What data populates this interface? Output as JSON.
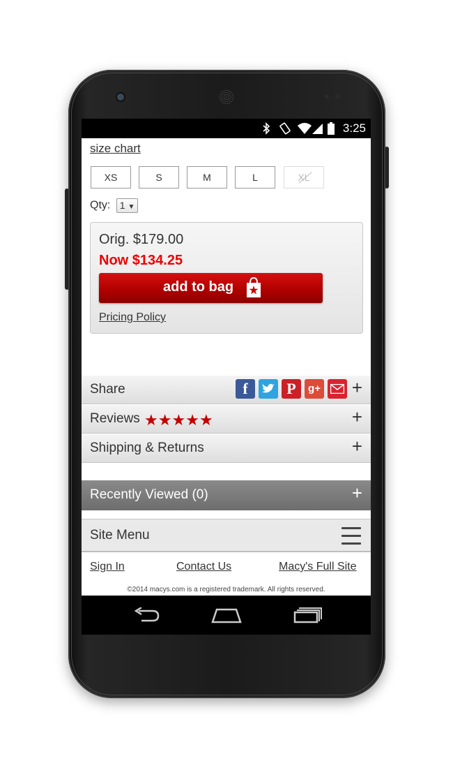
{
  "status_bar": {
    "time": "3:25",
    "icons": [
      "bluetooth-icon",
      "rotation-icon",
      "wifi-icon",
      "signal-icon",
      "battery-icon"
    ]
  },
  "product": {
    "size_chart_link": "size chart",
    "sizes": [
      {
        "label": "XS",
        "available": true
      },
      {
        "label": "S",
        "available": true
      },
      {
        "label": "M",
        "available": true
      },
      {
        "label": "L",
        "available": true
      },
      {
        "label": "XL",
        "available": false
      }
    ],
    "qty_label": "Qty:",
    "qty_value": "1",
    "orig_price": "Orig. $179.00",
    "now_price": "Now $134.25",
    "add_to_bag": "add to bag",
    "pricing_policy": "Pricing Policy"
  },
  "sections": {
    "share": {
      "label": "Share",
      "icons": [
        "facebook-icon",
        "twitter-icon",
        "pinterest-icon",
        "google-plus-icon",
        "email-icon"
      ]
    },
    "reviews": {
      "label": "Reviews",
      "rating": 5,
      "max_rating": 5
    },
    "shipping": {
      "label": "Shipping & Returns"
    },
    "plus": "+",
    "recently_viewed": "Recently Viewed (0)",
    "site_menu": "Site Menu"
  },
  "footer": {
    "sign_in": "Sign In",
    "contact_us": "Contact Us",
    "full_site": "Macy's Full Site",
    "copyright": "©2014 macys.com is a registered trademark. All rights reserved."
  },
  "colors": {
    "accent_red": "#cc0000",
    "price_red": "#e00000",
    "star_red": "#c40000"
  }
}
